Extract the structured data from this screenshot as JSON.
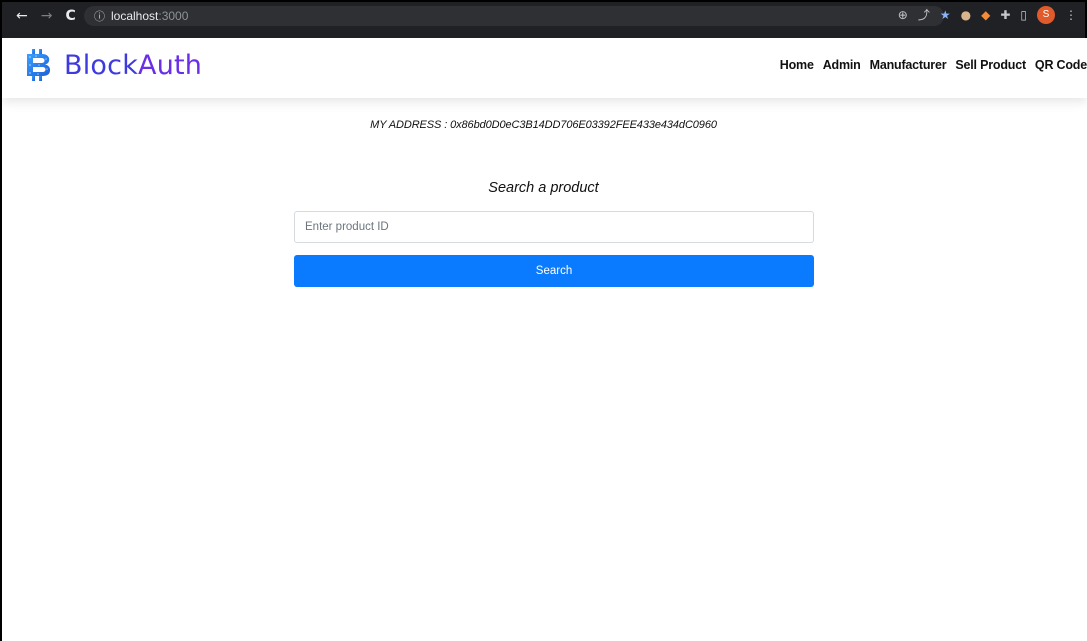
{
  "browser": {
    "back_icon": "←",
    "forward_icon": "→",
    "reload_icon": "C",
    "info_icon": "ⓘ",
    "url_host": "localhost",
    "url_port": ":3000",
    "share_icon": "⤴",
    "bookmark_icon": "★",
    "extension_icon": "✚",
    "sidepanel_icon": "▯",
    "profile_initial": "S",
    "menu_icon": "⋮"
  },
  "header": {
    "brand_part1": "Block",
    "brand_part2": "Auth",
    "nav": [
      "Home",
      "Admin",
      "Manufacturer",
      "Sell Product",
      "QR Code"
    ]
  },
  "main": {
    "address_text": "MY ADDRESS : 0x86bd0D0eC3B14DD706E03392FEE433e434dC0960",
    "search_title": "Search a product",
    "search_placeholder": "Enter product ID",
    "search_button": "Search"
  },
  "colors": {
    "brand": "#6a2ee8",
    "button": "#0a7bff",
    "chrome_bg": "#202124"
  }
}
